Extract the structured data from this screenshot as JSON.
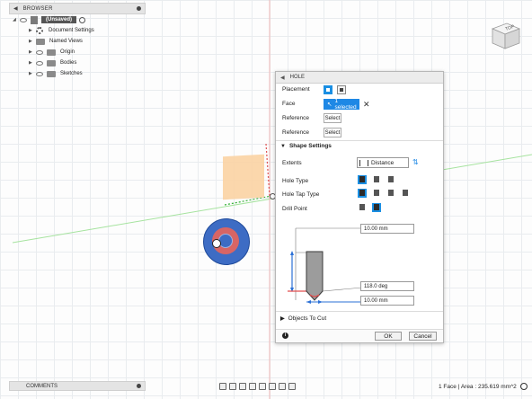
{
  "browser": {
    "title": "BROWSER",
    "document_name": "(Unsaved)",
    "items": [
      {
        "label": "Document Settings",
        "icon": "gear-icon"
      },
      {
        "label": "Named Views",
        "icon": "folder-icon"
      },
      {
        "label": "Origin",
        "icon": "folder-icon"
      },
      {
        "label": "Bodies",
        "icon": "folder-icon"
      },
      {
        "label": "Sketches",
        "icon": "folder-icon"
      }
    ]
  },
  "viewcube": {
    "face_label": "TOP"
  },
  "hole": {
    "title": "HOLE",
    "placement_label": "Placement",
    "face_label": "Face",
    "face_value": "1 selected",
    "reference1_label": "Reference",
    "reference1_value": "Select",
    "reference2_label": "Reference",
    "reference2_value": "Select",
    "shape_settings_label": "Shape Settings",
    "extents_label": "Extents",
    "extents_value": "Distance",
    "hole_type_label": "Hole Type",
    "hole_tap_type_label": "Hole Tap Type",
    "drill_point_label": "Drill Point",
    "depth_value": "10.00 mm",
    "angle_value": "118.0 deg",
    "diameter_value": "10.00 mm",
    "objects_to_cut_label": "Objects To Cut",
    "ok_label": "OK",
    "cancel_label": "Cancel",
    "accent_color": "#1e88e5"
  },
  "comments": {
    "title": "COMMENTS"
  },
  "status": {
    "text": "1 Face | Area : 235.619 mm^2"
  }
}
